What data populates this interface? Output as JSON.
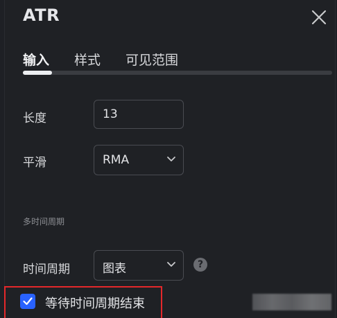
{
  "dialog": {
    "title": "ATR",
    "close_icon": "close-icon"
  },
  "tabs": [
    {
      "label": "输入",
      "active": true
    },
    {
      "label": "样式",
      "active": false
    },
    {
      "label": "可见范围",
      "active": false
    }
  ],
  "inputs": {
    "length": {
      "label": "长度",
      "value": "13"
    },
    "smoothing": {
      "label": "平滑",
      "value": "RMA",
      "icon": "chevron-down-icon"
    }
  },
  "multi_timeframe": {
    "section_title": "多时间周期",
    "timeframe": {
      "label": "时间周期",
      "value": "图表",
      "icon": "chevron-down-icon"
    },
    "help_icon": "question-icon",
    "help_glyph": "?",
    "wait_close": {
      "label": "等待时间周期结束",
      "checked": true
    }
  },
  "colors": {
    "background": "#1f2125",
    "accent": "#2962ff",
    "highlight_border": "#e5282b"
  }
}
